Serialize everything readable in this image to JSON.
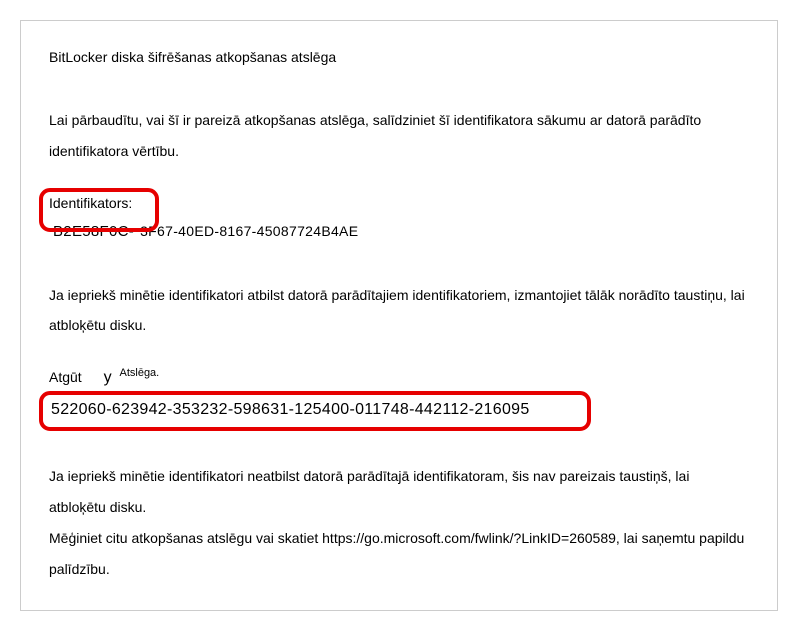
{
  "title": "BitLocker diska šifrēšanas atkopšanas atslēga",
  "intro": "Lai pārbaudītu, vai šī ir pareizā atkopšanas atslēga, salīdziniet šī identifikatora sākumu ar datorā parādīto identifikatora vērtību.",
  "identifier": {
    "label": "Identifikators:",
    "prefix": "B2E58F0C-",
    "rest": "3F67-40ED-8167-45087724B4AE"
  },
  "match_instruction": "Ja iepriekš minētie identifikatori atbilst datorā parādītajiem identifikatoriem, izmantojiet tālāk norādīto taustiņu, lai atbloķētu disku.",
  "recovery": {
    "label_part1": "Atgūt",
    "label_y": "y",
    "label_part2": "Atslēga.",
    "key": "522060-623942-353232-598631-125400-011748-442112-216095"
  },
  "footer": "Ja iepriekš minētie identifikatori neatbilst datorā parādītajā identifikatoram, šis nav pareizais taustiņš, lai atbloķētu disku.\nMēģiniet citu atkopšanas atslēgu vai skatiet https://go.microsoft.com/fwlink/?LinkID=260589, lai saņemtu papildu palīdzību."
}
